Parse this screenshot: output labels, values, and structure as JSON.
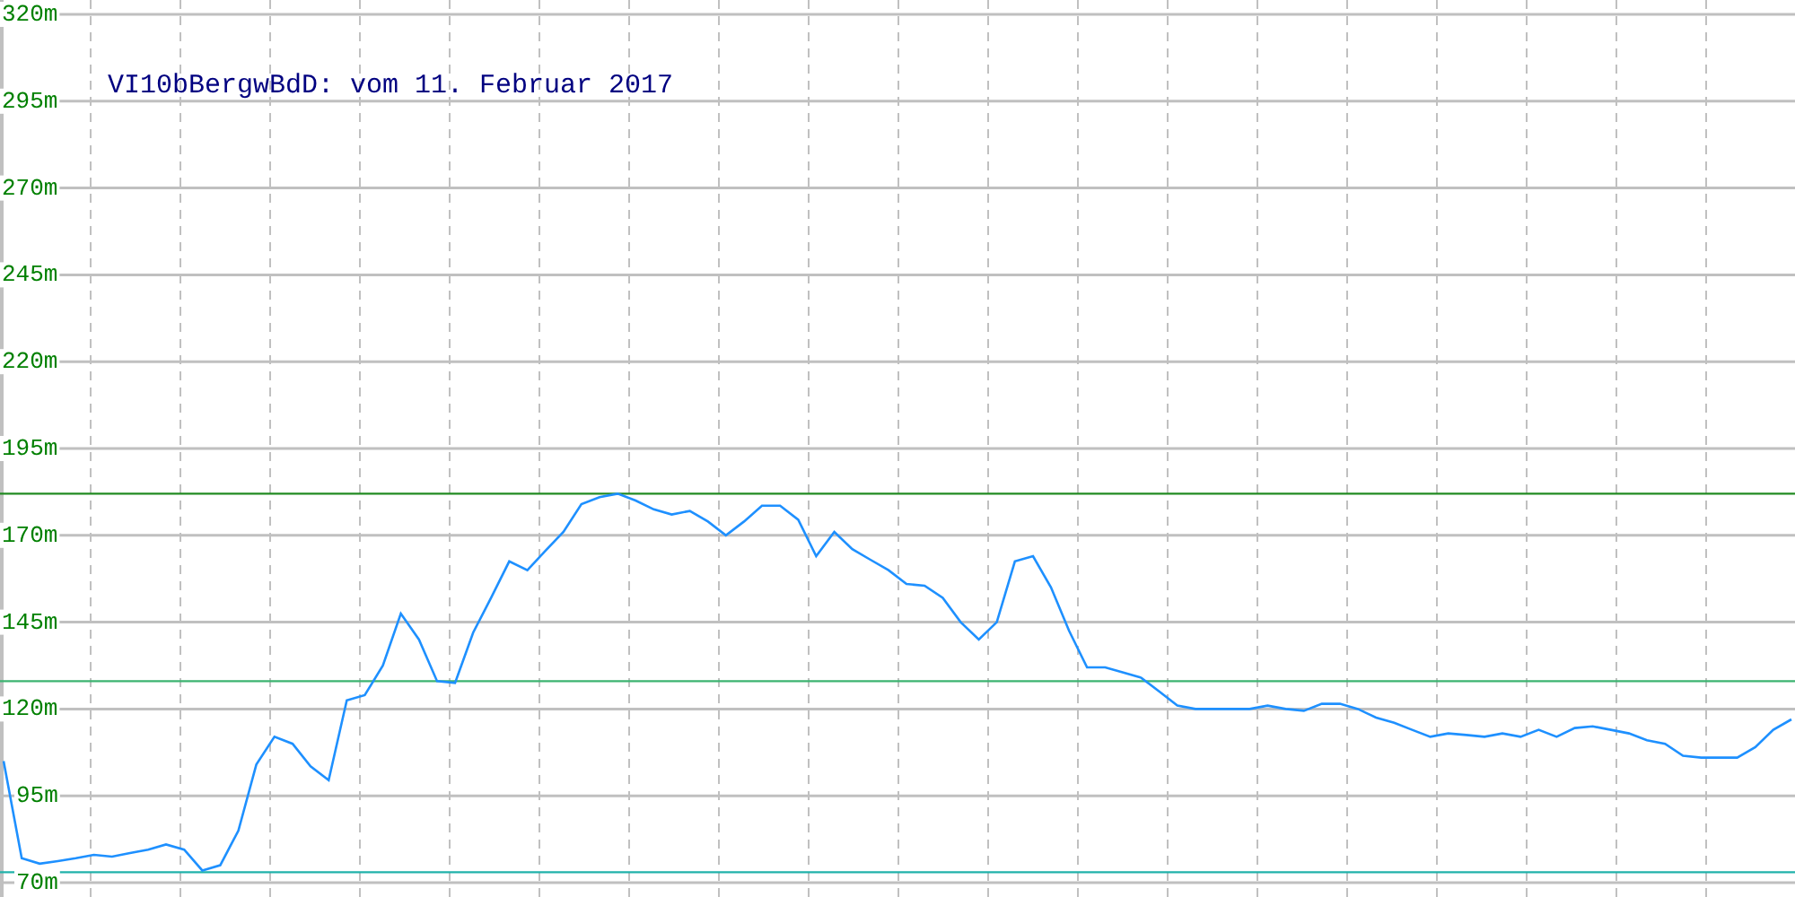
{
  "chart": {
    "chart_data": {
      "type": "line",
      "title": "VI10bBergwBdD: vom 11. Februar 2017",
      "ylim": [
        70,
        320
      ],
      "yticks": [
        {
          "value": 70,
          "label": "70m"
        },
        {
          "value": 95,
          "label": "95m"
        },
        {
          "value": 120,
          "label": "120m"
        },
        {
          "value": 145,
          "label": "145m"
        },
        {
          "value": 170,
          "label": "170m"
        },
        {
          "value": 195,
          "label": "195m"
        },
        {
          "value": 220,
          "label": "220m"
        },
        {
          "value": 245,
          "label": "245m"
        },
        {
          "value": 270,
          "label": "270m"
        },
        {
          "value": 295,
          "label": "295m"
        },
        {
          "value": 320,
          "label": "320m"
        }
      ],
      "categories": [
        null,
        null,
        null,
        null,
        null,
        null,
        null,
        null,
        null,
        null,
        null,
        null,
        null,
        null,
        null,
        null,
        null,
        null,
        null,
        null,
        null,
        null,
        null,
        null,
        null,
        null,
        null,
        null,
        null,
        null,
        null,
        null,
        null,
        null,
        null,
        null,
        null,
        null,
        null,
        null,
        null,
        null,
        null,
        null,
        null,
        null,
        null,
        null,
        null,
        null,
        null,
        null,
        null,
        null,
        null,
        null,
        null,
        null,
        null,
        null,
        null,
        null,
        null,
        null,
        null,
        null,
        null,
        null,
        null,
        null,
        null,
        null,
        null,
        null,
        null,
        null,
        null,
        null,
        null,
        null,
        null,
        null,
        null,
        null,
        null,
        null,
        null,
        null,
        null,
        null,
        null,
        null,
        null,
        null,
        null,
        null,
        null,
        null,
        null,
        null
      ],
      "series": [
        {
          "color": "#1e90ff",
          "values": [
            105,
            77,
            75.5,
            76.2,
            77,
            78,
            77.5,
            78.5,
            79.5,
            81,
            79.5,
            73.5,
            75,
            85,
            104,
            112,
            110,
            103.5,
            99.5,
            122.5,
            124,
            132.5,
            147.5,
            140,
            128,
            127.5,
            142,
            152,
            162.5,
            160,
            165.5,
            171,
            179,
            181,
            182,
            180,
            177.5,
            176,
            177,
            174,
            170,
            174,
            178.5,
            178.5,
            174.5,
            164,
            171,
            166,
            163,
            160,
            156,
            155.5,
            152,
            145,
            140,
            145,
            162.5,
            164,
            155,
            142.5,
            132,
            132,
            130.5,
            129,
            125,
            121,
            120,
            120,
            120,
            120,
            121,
            120,
            119.5,
            121.5,
            121.5,
            120,
            117.5,
            116,
            114,
            112,
            113,
            112.5,
            112,
            113,
            112,
            114,
            112,
            114.5,
            115,
            114,
            113,
            111,
            110,
            106.5,
            106,
            106,
            106,
            109,
            114,
            117
          ]
        }
      ],
      "grid": true,
      "ref_lines": [
        {
          "axis": "y",
          "value": 182,
          "color": "#228b22"
        },
        {
          "axis": "y",
          "value": 128,
          "color": "#3cb371"
        },
        {
          "axis": "y",
          "value": 73,
          "color": "#20b2aa"
        }
      ]
    }
  }
}
